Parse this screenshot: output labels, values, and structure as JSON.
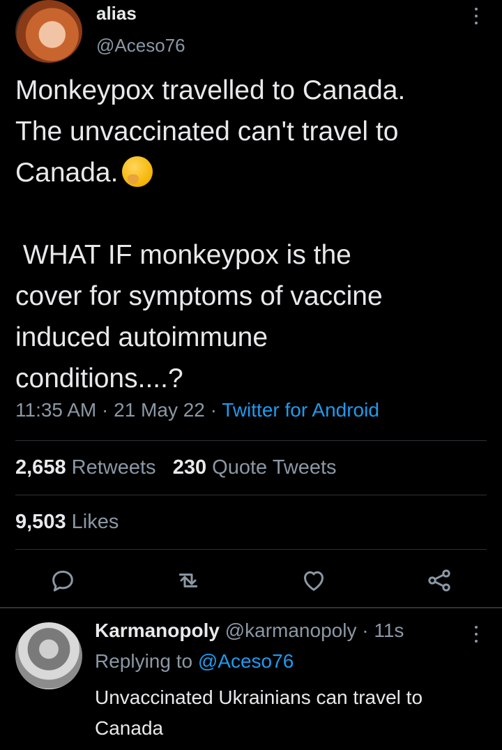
{
  "tweet": {
    "author_name": "alias",
    "author_handle": "@Aceso76",
    "text_line1": "Monkeypox travelled to Canada.",
    "text_line2": "The unvaccinated can't travel to",
    "text_line3": "Canada.",
    "text_para2": " WHAT IF monkeypox is the\ncover for symptoms of vaccine\ninduced autoimmune\nconditions....?",
    "emoji": "thinking-face",
    "time": "11:35 AM",
    "date": "21 May 22",
    "sep": "·",
    "source": "Twitter for Android"
  },
  "stats": {
    "retweets_count": "2,658",
    "retweets_label": "Retweets",
    "quotes_count": "230",
    "quotes_label": "Quote Tweets",
    "likes_count": "9,503",
    "likes_label": "Likes"
  },
  "actions": [
    "reply-icon",
    "retweet-icon",
    "like-icon",
    "share-icon"
  ],
  "reply": {
    "author_name": "Karmanopoly",
    "author_handle": "@karmanopoly",
    "sep": "·",
    "time": "11s",
    "replying_label": "Replying to",
    "replying_to": "@Aceso76",
    "text": "Unvaccinated Ukrainians can travel to Canada"
  },
  "colors": {
    "background": "#000000",
    "text": "#e7e9ea",
    "secondary": "#8b98a5",
    "link": "#1d9bf0",
    "divider": "#2f3336"
  }
}
